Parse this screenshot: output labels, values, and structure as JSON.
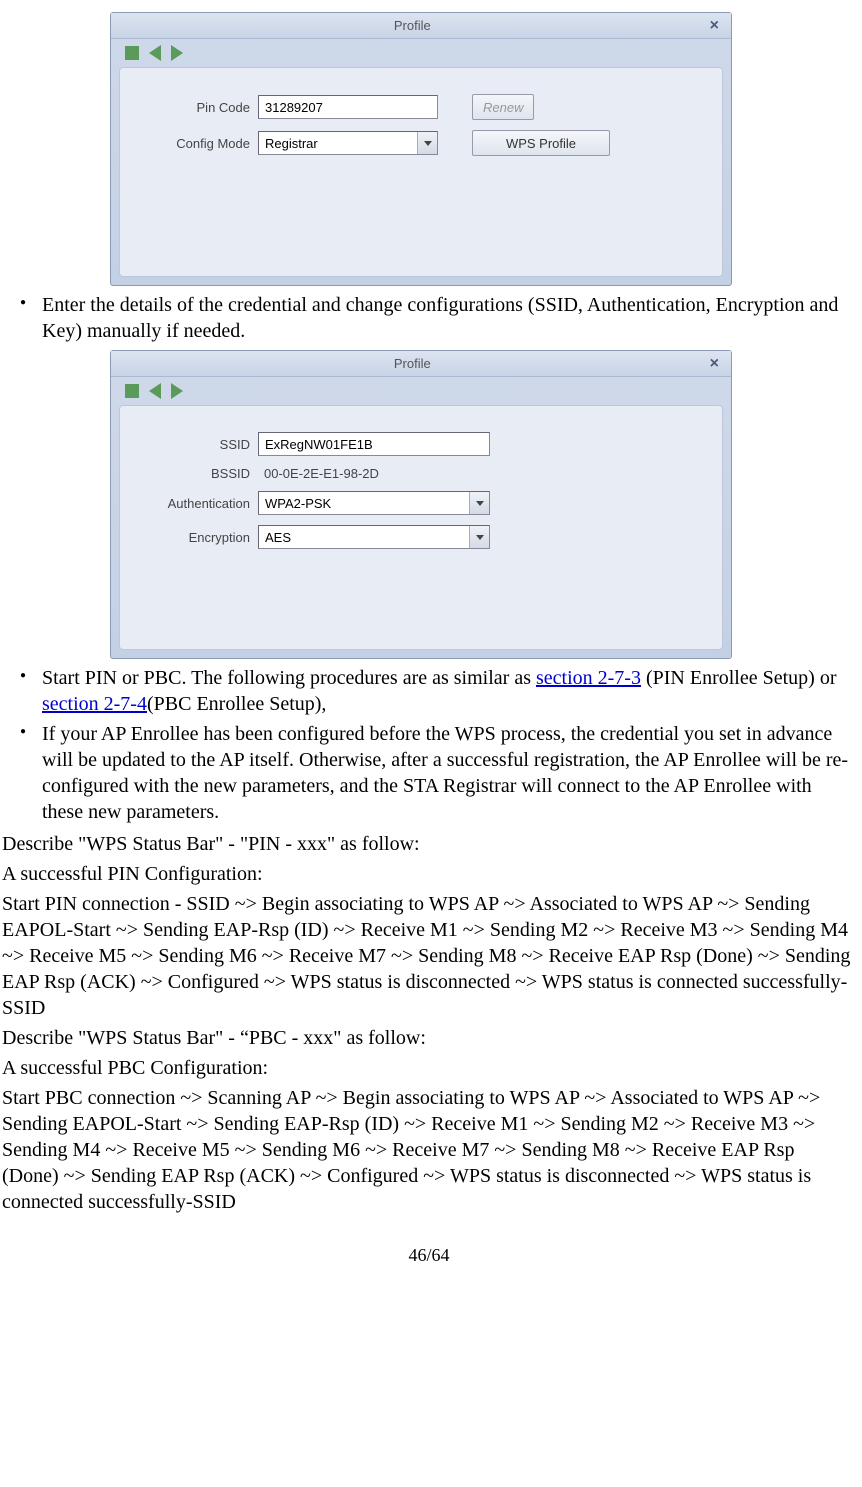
{
  "dialog1": {
    "title": "Profile",
    "pin_label": "Pin Code",
    "pin_value": "31289207",
    "renew_label": "Renew",
    "config_label": "Config Mode",
    "config_value": "Registrar",
    "wps_button": "WPS Profile"
  },
  "bullet1": "Enter the details of the credential and change configurations (SSID, Authentication, Encryption and Key) manually if needed.",
  "dialog2": {
    "title": "Profile",
    "ssid_label": "SSID",
    "ssid_value": "ExRegNW01FE1B",
    "bssid_label": "BSSID",
    "bssid_value": "00-0E-2E-E1-98-2D",
    "auth_label": "Authentication",
    "auth_value": "WPA2-PSK",
    "enc_label": "Encryption",
    "enc_value": "AES"
  },
  "bullet2_pre": "Start PIN or PBC. The following procedures are as similar as ",
  "bullet2_link1": "section 2-7-3",
  "bullet2_mid": " (PIN Enrollee Setup) or ",
  "bullet2_link2": "section 2-7-4",
  "bullet2_post": "(PBC Enrollee Setup),",
  "bullet3": "If your AP Enrollee has been configured before the WPS process, the credential you set in advance will be updated to the AP itself. Otherwise, after a successful registration, the AP Enrollee will be re-configured with the new parameters, and the STA Registrar will connect to the AP Enrollee with these new parameters.",
  "para1": "Describe \"WPS Status Bar\" - \"PIN - xxx\" as follow:",
  "para2": "A successful PIN Configuration:",
  "para3": "Start PIN connection - SSID ~> Begin associating to WPS AP ~> Associated to WPS AP ~> Sending EAPOL-Start ~> Sending EAP-Rsp (ID) ~> Receive M1 ~> Sending M2 ~> Receive M3 ~> Sending M4 ~> Receive M5 ~> Sending M6 ~> Receive M7 ~> Sending M8 ~> Receive EAP Rsp (Done) ~> Sending EAP Rsp (ACK) ~> Configured ~> WPS status is disconnected ~> WPS status is connected successfully-SSID",
  "para4": "Describe \"WPS Status Bar\" - “PBC - xxx\" as follow:",
  "para5": "A successful PBC Configuration:",
  "para6": "Start PBC connection ~> Scanning AP ~> Begin associating to WPS AP ~> Associated to WPS AP ~> Sending EAPOL-Start ~> Sending EAP-Rsp (ID) ~> Receive M1 ~> Sending M2 ~> Receive M3 ~> Sending M4 ~> Receive M5 ~> Sending M6 ~> Receive M7 ~> Sending M8 ~> Receive EAP Rsp (Done) ~> Sending EAP Rsp (ACK) ~> Configured ~> WPS status is disconnected ~> WPS status is connected successfully-SSID",
  "pagenum": "46/64"
}
